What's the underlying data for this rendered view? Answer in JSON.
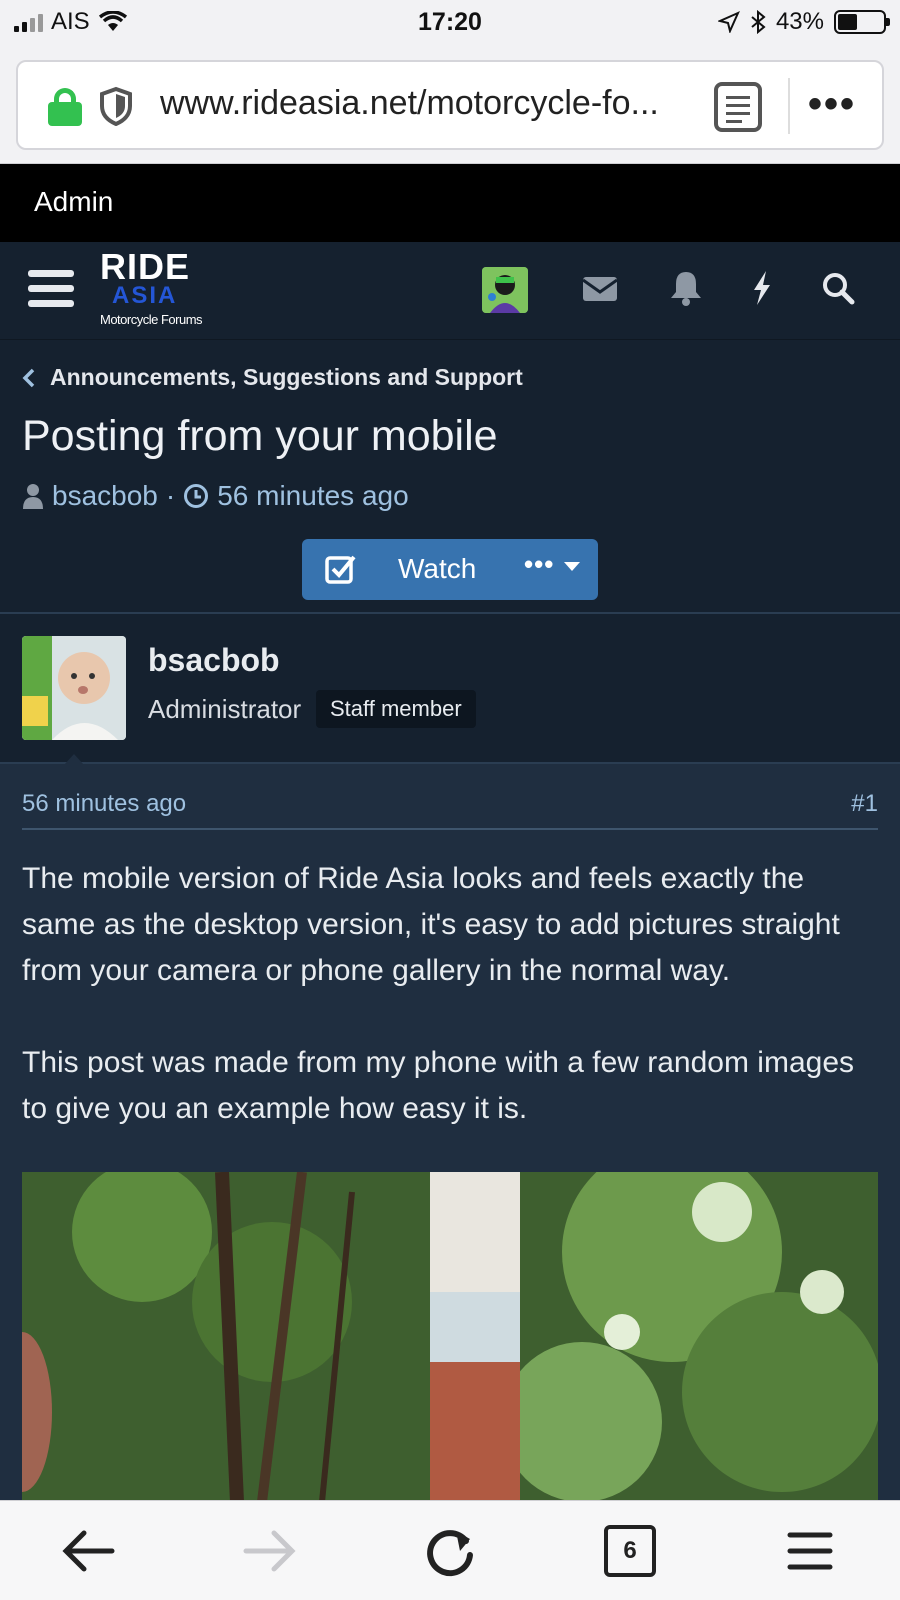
{
  "status_bar": {
    "carrier": "AIS",
    "time": "17:20",
    "battery": "43%",
    "battery_level": 0.43
  },
  "browser": {
    "url": "www.rideasia.net/motorcycle-fo...",
    "tab_count": "6"
  },
  "admin_bar": {
    "label": "Admin"
  },
  "header": {
    "logo_top": "RIDE",
    "logo_middle": "ASIA",
    "logo_bottom": "Motorcycle Forums",
    "icons": [
      "menu-icon",
      "envelope-icon",
      "bell-icon",
      "bolt-icon",
      "search-icon"
    ]
  },
  "thread": {
    "breadcrumb": "Announcements, Suggestions and Support",
    "title": "Posting from your mobile",
    "author": "bsacbob",
    "time": "56 minutes ago",
    "watch_label": "Watch",
    "more_label": "•••"
  },
  "post": {
    "username": "bsacbob",
    "role": "Administrator",
    "badge": "Staff member",
    "time": "56 minutes ago",
    "number": "#1",
    "paragraphs": [
      "The mobile version of Ride Asia looks and feels exactly the same as the desktop version, it's easy to add pictures straight from your camera or phone gallery in the normal way.",
      "This post was made from my phone with a few random images to give you an example how easy it is."
    ]
  },
  "colors": {
    "header_bg": "#15212f",
    "post_bg": "#1f2e40",
    "accent_blue": "#3773af",
    "link_blue": "#9fc1e0"
  }
}
